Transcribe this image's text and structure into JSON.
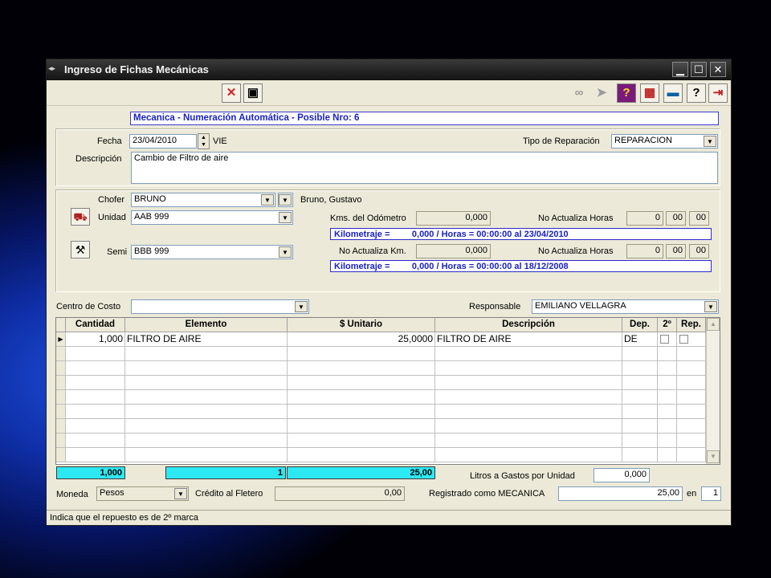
{
  "window": {
    "title": "Ingreso de Fichas Mecánicas",
    "controls": {
      "minimize": "▁",
      "maximize": "☐",
      "close": "✕"
    }
  },
  "toolbar": {
    "left": [
      {
        "icon": "cancel-x-icon",
        "glyph": "✕",
        "color": "#d42020"
      },
      {
        "icon": "save-disk-icon",
        "glyph": "▣",
        "color": "#202020"
      }
    ],
    "right": [
      {
        "icon": "binoculars-icon",
        "glyph": "∞",
        "color": "#9a9a9a"
      },
      {
        "icon": "pointer-icon",
        "glyph": "➤",
        "color": "#9a9a9a"
      },
      {
        "icon": "help-question-icon",
        "glyph": "?",
        "color": "#f2e020"
      },
      {
        "icon": "grid-layout-icon",
        "glyph": "▦",
        "color": "#c02020"
      },
      {
        "icon": "calculator-icon",
        "glyph": "▬",
        "color": "#1060a0"
      },
      {
        "icon": "help-pointer-icon",
        "glyph": "?",
        "color": "#202020"
      },
      {
        "icon": "exit-door-icon",
        "glyph": "⇥",
        "color": "#c02020"
      }
    ]
  },
  "banner": "Mecanica - Numeración Automática - Posible Nro: 6",
  "header": {
    "fecha_label": "Fecha",
    "fecha_value": "23/04/2010",
    "fecha_day": "VIE",
    "tipo_label": "Tipo de Reparación",
    "tipo_value": "REPARACION",
    "descripcion_label": "Descripción",
    "descripcion_value": "Cambio de Filtro de aire"
  },
  "vehicle": {
    "chofer_label": "Chofer",
    "chofer_value": "BRUNO",
    "chofer_name": "Bruno, Gustavo",
    "unidad_label": "Unidad",
    "unidad_value": "AAB 999",
    "semi_label": "Semi",
    "semi_value": "BBB 999",
    "kms_odometro_label": "Kms. del Odómetro",
    "kms_odometro_value": "0,000",
    "no_act_horas_label": "No Actualiza Horas",
    "horas_unidad": [
      "0",
      "00",
      "00"
    ],
    "kilometraje_unidad": "Kilometraje =         0,000 / Horas = 00:00:00 al 23/04/2010",
    "no_act_km_label": "No Actualiza Km.",
    "no_act_km_value": "0,000",
    "no_act_horas2_label": "No Actualiza Horas",
    "horas_semi": [
      "0",
      "00",
      "00"
    ],
    "kilometraje_semi": "Kilometraje =         0,000 / Horas = 00:00:00 al 18/12/2008"
  },
  "costs": {
    "centro_label": "Centro de Costo",
    "centro_value": "",
    "responsable_label": "Responsable",
    "responsable_value": "EMILIANO VELLAGRA"
  },
  "grid": {
    "columns": [
      "Cantidad",
      "Elemento",
      "$ Unitario",
      "Descripción",
      "Dep.",
      "2º",
      "Rep."
    ],
    "rows": [
      {
        "cantidad": "1,000",
        "elemento": "FILTRO DE AIRE",
        "unitario": "25,0000",
        "descripcion": "FILTRO DE AIRE",
        "dep": "DE"
      }
    ],
    "current_row_marker": "▶"
  },
  "totals": {
    "cantidad": "1,000",
    "elementos": "1",
    "importe": "25,00",
    "litros_label": "Litros a Gastos por Unidad",
    "litros_value": "0,000"
  },
  "footer": {
    "moneda_label": "Moneda",
    "moneda_value": "Pesos",
    "credito_label": "Crédito al Fletero",
    "credito_value": "0,00",
    "registrado_label": "Registrado como MECANICA",
    "registrado_value": "25,00",
    "en_label": "en",
    "en_value": "1"
  },
  "status": "Indica que el repuesto es de 2º marca"
}
